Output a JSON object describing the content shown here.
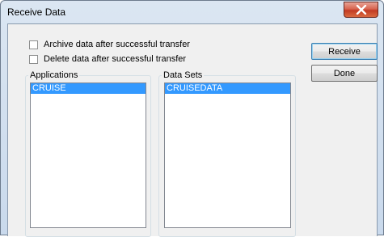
{
  "window": {
    "title": "Receive Data",
    "close_label": "close"
  },
  "options": {
    "archive": {
      "label": "Archive data after successful transfer",
      "checked": false
    },
    "delete": {
      "label": "Delete data after successful transfer",
      "checked": false
    }
  },
  "buttons": {
    "receive": "Receive",
    "done": "Done"
  },
  "applications": {
    "legend": "Applications",
    "items": [
      "CRUISE"
    ],
    "selected_index": 0
  },
  "data_sets": {
    "legend": "Data Sets",
    "items": [
      "CRUISEDATA"
    ],
    "selected_index": 0
  },
  "colors": {
    "selection": "#3399ff",
    "client_bg": "#f0f0f0",
    "close_red": "#c23b24"
  }
}
